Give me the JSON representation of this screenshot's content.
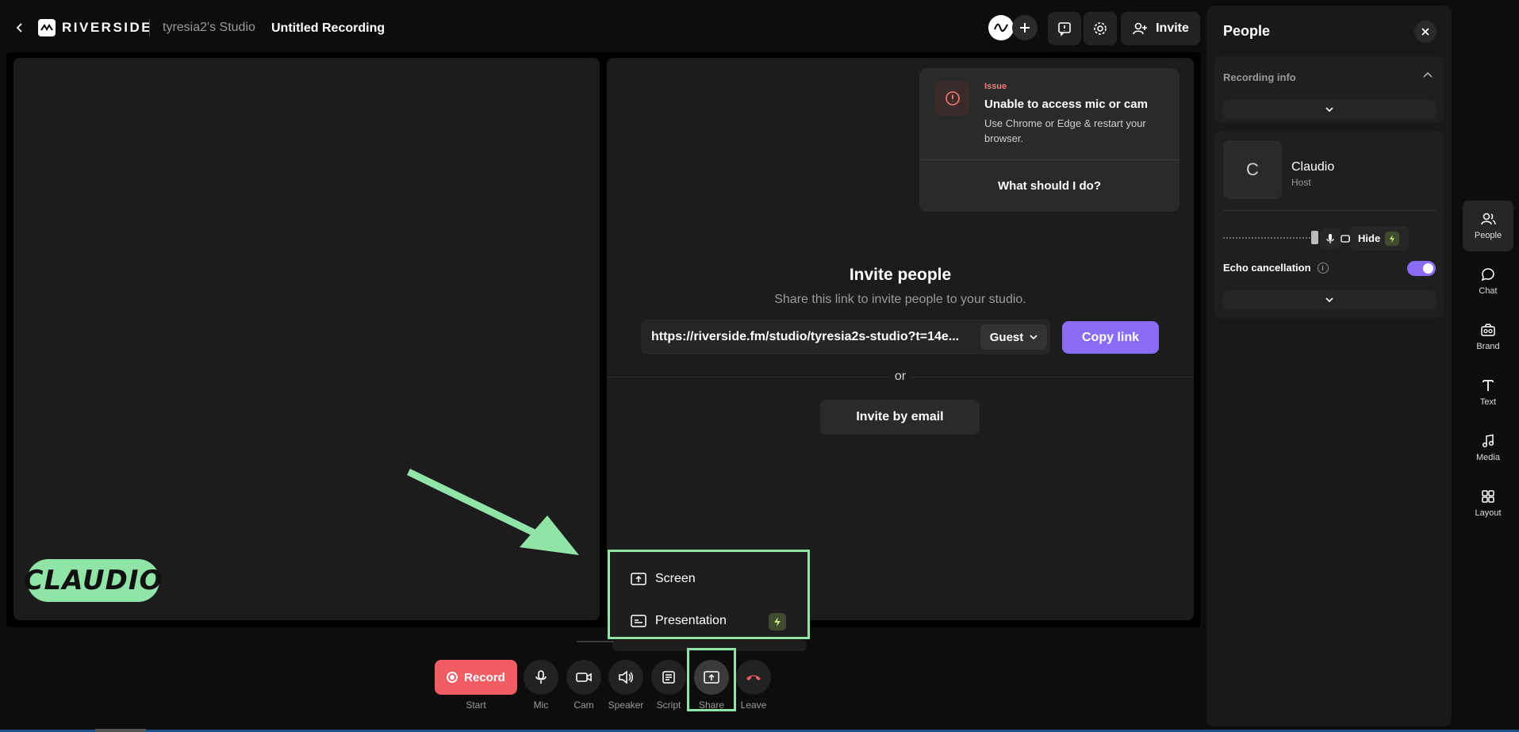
{
  "topbar": {
    "logo_text": "RIVERSIDE",
    "studio_name": "tyresia2's Studio",
    "recording_title": "Untitled Recording",
    "invite_label": "Invite"
  },
  "stage": {
    "participant_name_tag": "CLAUDIO",
    "issue": {
      "tag": "Issue",
      "title": "Unable to access mic or cam",
      "description": "Use Chrome or Edge & restart your browser.",
      "action": "What should I do?"
    },
    "invite": {
      "title": "Invite people",
      "subtitle": "Share this link to invite people to your studio.",
      "link": "https://riverside.fm/studio/tyresia2s-studio?t=14e...",
      "role_select": "Guest",
      "copy_label": "Copy link",
      "or_text": "or",
      "email_label": "Invite by email"
    }
  },
  "share_menu": {
    "items": [
      {
        "label": "Screen",
        "icon": "screen-share-icon"
      },
      {
        "label": "Presentation",
        "icon": "presentation-icon"
      }
    ]
  },
  "toolbar": {
    "record_label": "Record",
    "record_caption": "Start",
    "mic_caption": "Mic",
    "cam_caption": "Cam",
    "speaker_caption": "Speaker",
    "script_caption": "Script",
    "share_caption": "Share",
    "leave_caption": "Leave"
  },
  "people_panel": {
    "title": "People",
    "recording_info_label": "Recording info",
    "user": {
      "initial": "C",
      "name": "Claudio",
      "role": "Host",
      "hide_label": "Hide",
      "echo_label": "Echo cancellation",
      "echo_enabled": true
    }
  },
  "side_nav": {
    "items": [
      {
        "label": "People",
        "icon": "people-icon",
        "active": true
      },
      {
        "label": "Chat",
        "icon": "chat-icon",
        "active": false
      },
      {
        "label": "Brand",
        "icon": "brand-icon",
        "active": false
      },
      {
        "label": "Text",
        "icon": "text-icon",
        "active": false
      },
      {
        "label": "Media",
        "icon": "media-icon",
        "active": false
      },
      {
        "label": "Layout",
        "icon": "layout-icon",
        "active": false
      }
    ]
  },
  "colors": {
    "accent_purple": "#8b6cf6",
    "record_red": "#f25c63",
    "annotation_green": "#90e4a8",
    "issue_red": "#f07a7a"
  }
}
